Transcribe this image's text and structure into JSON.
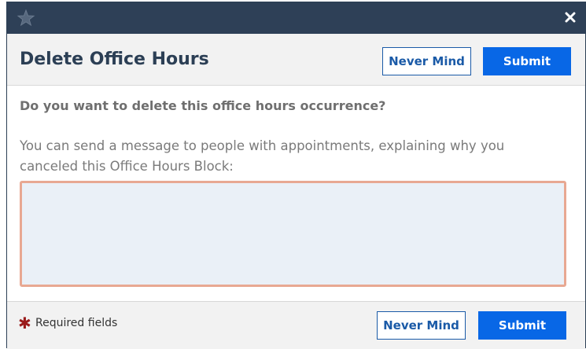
{
  "dialog": {
    "title": "Delete Office Hours",
    "never_mind_label": "Never Mind",
    "submit_label": "Submit",
    "question": "Do you want to delete this office hours occurrence?",
    "prompt": "You can send a message to people with appointments, explaining why you canceled this Office Hours Block:",
    "message_value": "",
    "message_placeholder": ""
  },
  "footer": {
    "required_marker": "✱",
    "required_label": "Required fields",
    "never_mind_label": "Never Mind",
    "submit_label": "Submit"
  },
  "icons": {
    "logo": "star-logo-icon",
    "close": "close-icon"
  },
  "colors": {
    "topbar": "#2e4057",
    "title": "#2c3f55",
    "primary_button": "#0867e6",
    "outline_button": "#1a5aa7",
    "textarea_border": "#e8a892",
    "textarea_bg": "#eaf0f7",
    "required_star": "#9b1c1c"
  }
}
